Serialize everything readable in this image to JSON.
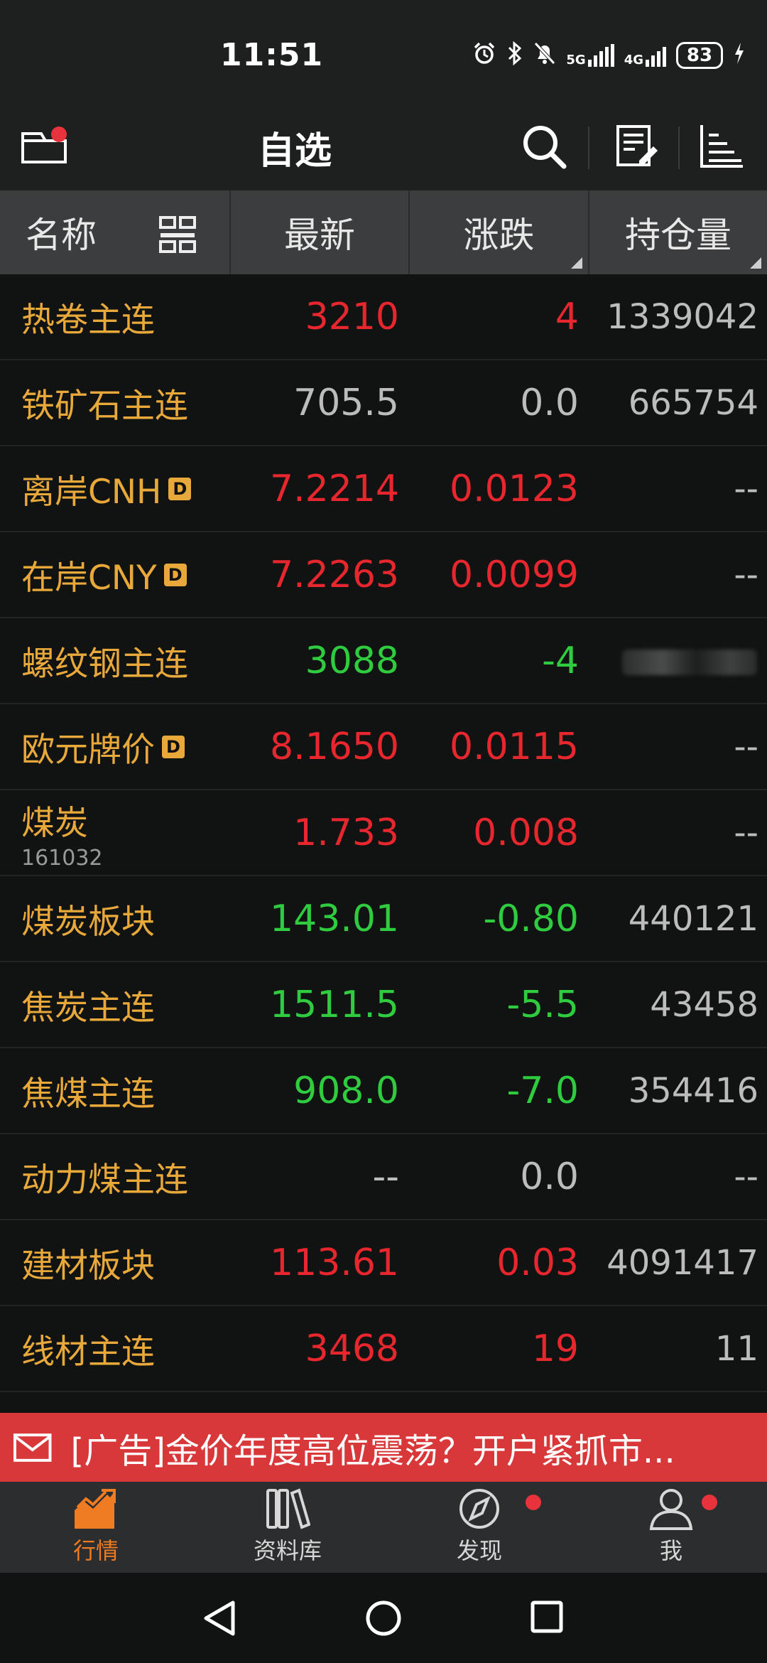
{
  "status": {
    "time": "11:51",
    "network_5g": "5G",
    "network_4g": "4G",
    "battery": "83"
  },
  "topbar": {
    "title": "自选"
  },
  "columns": {
    "name": "名称",
    "latest": "最新",
    "change": "涨跌",
    "open_interest": "持仓量"
  },
  "rows": [
    {
      "name": "热卷主连",
      "code": "",
      "badge": "",
      "latest": "3210",
      "change": "4",
      "oi": "1339042",
      "dir": "up"
    },
    {
      "name": "铁矿石主连",
      "code": "",
      "badge": "",
      "latest": "705.5",
      "change": "0.0",
      "oi": "665754",
      "dir": "flat"
    },
    {
      "name": "离岸CNH",
      "code": "",
      "badge": "D",
      "latest": "7.2214",
      "change": "0.0123",
      "oi": "--",
      "dir": "up"
    },
    {
      "name": "在岸CNY",
      "code": "",
      "badge": "D",
      "latest": "7.2263",
      "change": "0.0099",
      "oi": "--",
      "dir": "up"
    },
    {
      "name": "螺纹钢主连",
      "code": "",
      "badge": "",
      "latest": "3088",
      "change": "-4",
      "oi": "",
      "dir": "down"
    },
    {
      "name": "欧元牌价",
      "code": "",
      "badge": "D",
      "latest": "8.1650",
      "change": "0.0115",
      "oi": "--",
      "dir": "up"
    },
    {
      "name": "煤炭",
      "code": "161032",
      "badge": "",
      "latest": "1.733",
      "change": "0.008",
      "oi": "--",
      "dir": "up"
    },
    {
      "name": "煤炭板块",
      "code": "",
      "badge": "",
      "latest": "143.01",
      "change": "-0.80",
      "oi": "440121",
      "dir": "down"
    },
    {
      "name": "焦炭主连",
      "code": "",
      "badge": "",
      "latest": "1511.5",
      "change": "-5.5",
      "oi": "43458",
      "dir": "down"
    },
    {
      "name": "焦煤主连",
      "code": "",
      "badge": "",
      "latest": "908.0",
      "change": "-7.0",
      "oi": "354416",
      "dir": "down"
    },
    {
      "name": "动力煤主连",
      "code": "",
      "badge": "",
      "latest": "--",
      "change": "0.0",
      "oi": "--",
      "dir": "flat"
    },
    {
      "name": "建材板块",
      "code": "",
      "badge": "",
      "latest": "113.61",
      "change": "0.03",
      "oi": "4091417",
      "dir": "up"
    },
    {
      "name": "线材主连",
      "code": "",
      "badge": "",
      "latest": "3468",
      "change": "19",
      "oi": "11",
      "dir": "up"
    }
  ],
  "ad": {
    "text": "[广告]金价年度高位震荡？开户紧抓市..."
  },
  "tabs": [
    {
      "label": "行情",
      "active": true,
      "dot": false
    },
    {
      "label": "资料库",
      "active": false,
      "dot": false
    },
    {
      "label": "发现",
      "active": false,
      "dot": true
    },
    {
      "label": "我",
      "active": false,
      "dot": true
    }
  ],
  "colors": {
    "up": "#e8262e",
    "down": "#2ecc3e",
    "flat": "#bcbcbc",
    "name": "#e9a93a",
    "accent": "#ef7b22",
    "ad_bg": "#d9383a"
  }
}
